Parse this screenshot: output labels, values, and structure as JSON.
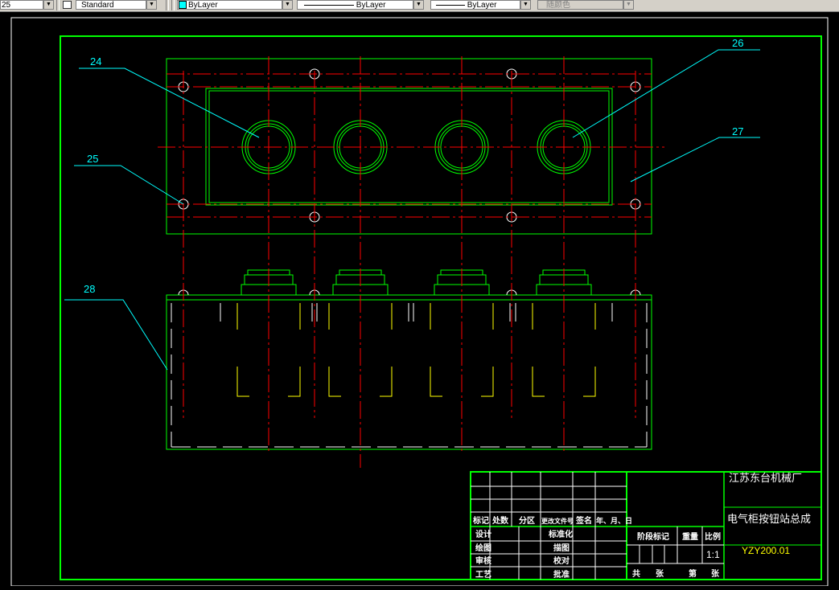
{
  "toolbar": {
    "dimstyle_value": "25",
    "textstyle_value": "Standard",
    "layer_color_value": "ByLayer",
    "linetype_value": "ByLayer",
    "lineweight_value": "ByLayer",
    "plotstyle_value": "随颜色"
  },
  "drawing": {
    "leaders": [
      "24",
      "25",
      "26",
      "27",
      "28"
    ],
    "title_block": {
      "company": "江苏东台机械厂",
      "drawing_title": "电气柜按钮站总成",
      "drawing_number": "YZY200.01",
      "scale": "1:1",
      "header_row": [
        "标记",
        "处数",
        "分区",
        "更改文件号",
        "签名",
        "年、月、日"
      ],
      "role_rows": [
        {
          "left": "设计",
          "right": "标准化"
        },
        {
          "left": "绘图",
          "right": "描图"
        },
        {
          "left": "审核",
          "right": "校对"
        },
        {
          "left": "工艺",
          "right": "批准"
        }
      ],
      "stage_label": "阶段标记",
      "weight_label": "重量",
      "scale_label": "比例",
      "total_sheets": "共",
      "sheets_unit": "张",
      "sheet_no": "第",
      "sheet_unit": "张"
    }
  },
  "colors": {
    "frame": "#00ff00",
    "centerline": "#ff0000",
    "leader": "#00ffff",
    "hidden": "#ffff00",
    "text": "#00ffff",
    "tb_text": "#ffffff",
    "background": "#000000"
  }
}
